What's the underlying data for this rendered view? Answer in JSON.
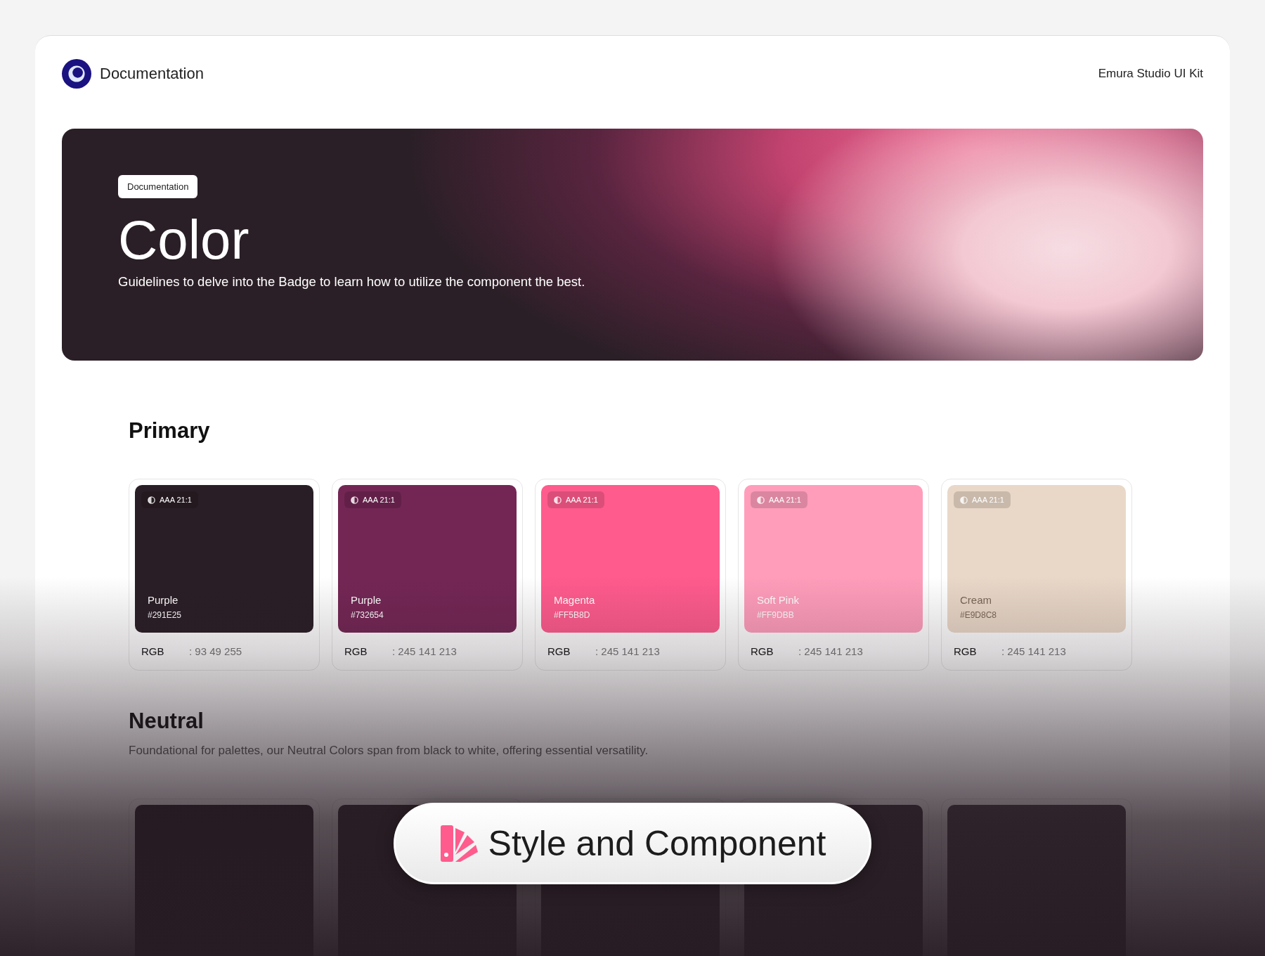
{
  "header": {
    "title": "Documentation",
    "kit": "Emura Studio UI Kit"
  },
  "hero": {
    "badge": "Documentation",
    "title": "Color",
    "subtitle": "Guidelines to delve into the Badge to learn how to utilize the component the best."
  },
  "primary": {
    "title": "Primary",
    "swatches": [
      {
        "badge": "AAA 21:1",
        "name": "Purple",
        "hex": "#291E25",
        "color": "#291e25",
        "rgb_label": "RGB",
        "rgb": ": 93 49 255"
      },
      {
        "badge": "AAA 21:1",
        "name": "Purple",
        "hex": "#732654",
        "color": "#732654",
        "rgb_label": "RGB",
        "rgb": ": 245 141 213"
      },
      {
        "badge": "AAA 21:1",
        "name": "Magenta",
        "hex": "#FF5B8D",
        "color": "#ff5b8d",
        "rgb_label": "RGB",
        "rgb": ": 245 141 213"
      },
      {
        "badge": "AAA 21:1",
        "name": "Soft Pink",
        "hex": "#FF9DBB",
        "color": "#ff9dbb",
        "rgb_label": "RGB",
        "rgb": ": 245 141 213"
      },
      {
        "badge": "AAA 21:1",
        "name": "Cream",
        "hex": "#E9D8C8",
        "color": "#e9d8c8",
        "rgb_label": "RGB",
        "rgb": ": 245 141 213"
      }
    ]
  },
  "neutral": {
    "title": "Neutral",
    "description": "Foundational for palettes, our Neutral Colors span from black to white, offering essential versatility.",
    "swatches": [
      {
        "color": "#1f171c"
      },
      {
        "color": "#2a2127"
      },
      {
        "color": "#2e252b"
      },
      {
        "color": "#342b31"
      },
      {
        "color": "#403840"
      }
    ]
  },
  "pill": {
    "label": "Style and Component"
  }
}
